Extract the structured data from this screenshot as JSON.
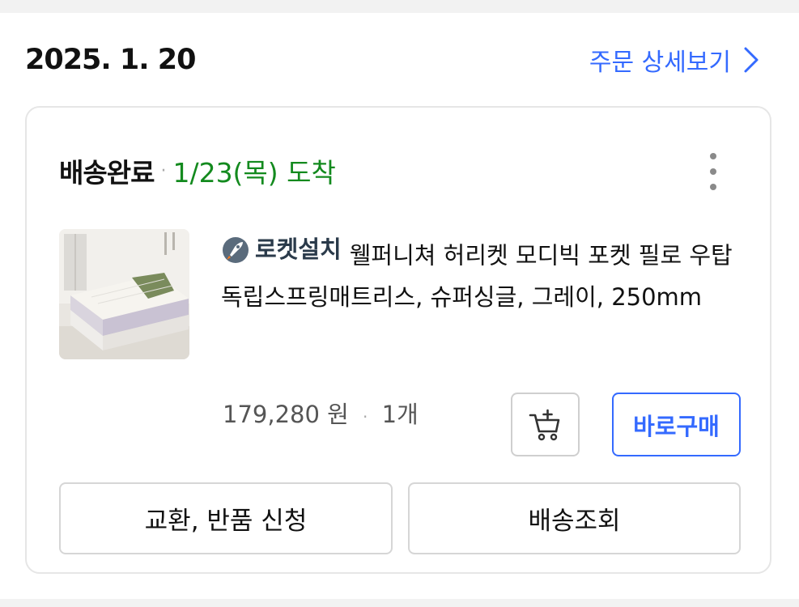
{
  "order": {
    "date": "2025. 1. 20",
    "detail_link_label": "주문 상세보기"
  },
  "delivery": {
    "status": "배송완료",
    "separator": "·",
    "arrival": "1/23(목) 도착"
  },
  "product": {
    "badge_label": "로켓설치",
    "title": "웰퍼니쳐 허리켓 모디빅 포켓 필로 우탑 독립스프링매트리스, 슈퍼싱글, 그레이, 250mm",
    "price": "179,280 원",
    "separator": "·",
    "quantity": "1개"
  },
  "buttons": {
    "buy_now": "바로구매",
    "exchange_return": "교환, 반품 신청",
    "track_delivery": "배송조회"
  },
  "colors": {
    "accent": "#346aff",
    "arrival_green": "#138a1e"
  },
  "icons": {
    "detail_chevron": "chevron-right-icon",
    "more": "more-vertical-icon",
    "cart": "add-to-cart-icon",
    "rocket": "rocket-icon"
  }
}
